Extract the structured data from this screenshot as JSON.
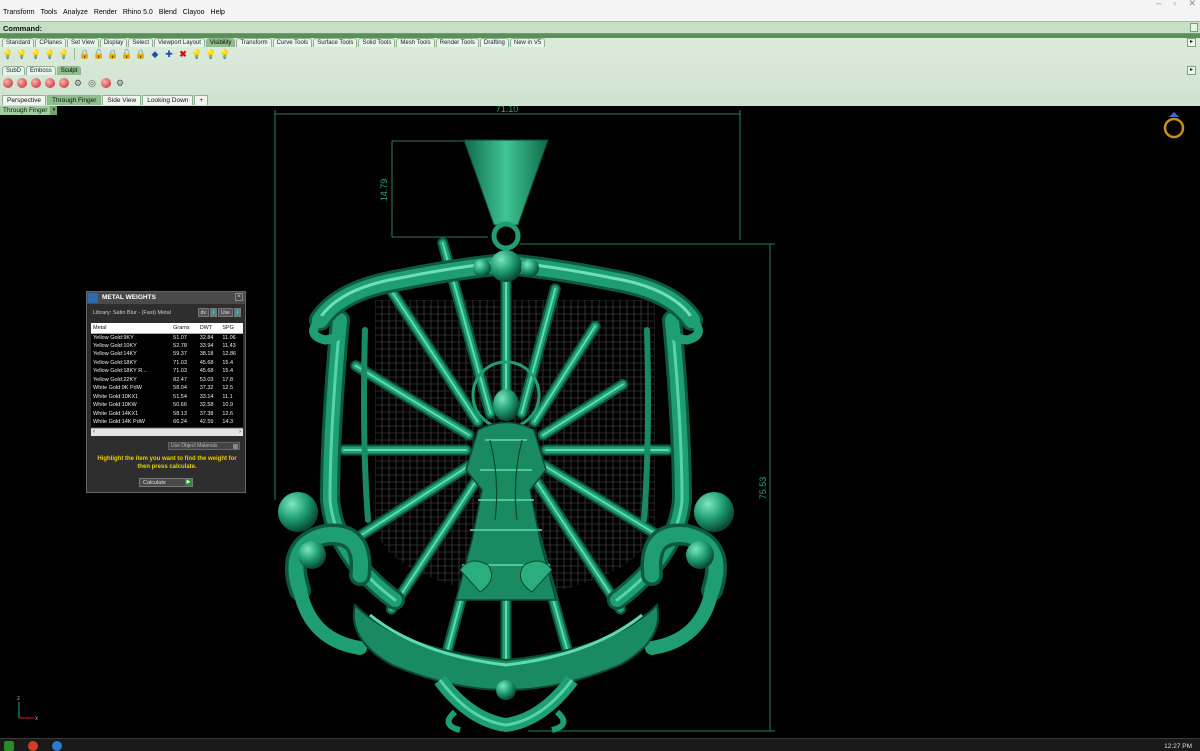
{
  "menu": [
    "Transform",
    "Tools",
    "Analyze",
    "Render",
    "Rhino 5.0",
    "Blend",
    "Clayoo",
    "Help"
  ],
  "command": {
    "label": "Command:"
  },
  "toolbar_tabs": [
    "Standard",
    "CPlanes",
    "Set View",
    "Display",
    "Select",
    "Viewport Layout",
    "Visibility",
    "Transform",
    "Curve Tools",
    "Surface Tools",
    "Solid Tools",
    "Mesh Tools",
    "Render Tools",
    "Drafting",
    "New in V5"
  ],
  "toolbar_tabs_active": 6,
  "sub_tabs": [
    "SubD",
    "Emboss",
    "Sculpt"
  ],
  "sub_tabs_active": 2,
  "viewport_tabs": [
    "Perspective",
    "Through Finger",
    "Side View",
    "Looking Down",
    "+"
  ],
  "viewport_tabs_active": 1,
  "viewport_label": "Through Finger",
  "dimensions": {
    "width": "71.10",
    "bail": "14.79",
    "height": "75.53"
  },
  "axis": {
    "z": "z",
    "x": "x"
  },
  "metal_weights": {
    "title": "METAL WEIGHTS",
    "library": "Library: Satin Blur - (Fast) Metal",
    "library_ctl": [
      "dv",
      "i",
      "Use",
      "i"
    ],
    "columns": [
      "Metal",
      "Grams",
      "DWT",
      "SPG"
    ],
    "rows": [
      [
        "Yellow Gold:9KY",
        "51.07",
        "32.84",
        "11.06"
      ],
      [
        "Yellow Gold:10KY",
        "52.78",
        "33.94",
        "11.43"
      ],
      [
        "Yellow Gold:14KY",
        "59.37",
        "38.18",
        "12.86"
      ],
      [
        "Yellow Gold:18KY",
        "71.03",
        "45.68",
        "15.4"
      ],
      [
        "Yellow Gold:18KY R...",
        "71.03",
        "45.68",
        "15.4"
      ],
      [
        "Yellow Gold:22KY",
        "82.47",
        "53.03",
        "17.8"
      ],
      [
        "White Gold:9K PdW",
        "58.04",
        "37.32",
        "12.5"
      ],
      [
        "White Gold:10KX1",
        "51.54",
        "33.14",
        "11.1"
      ],
      [
        "White Gold:10KW",
        "50.66",
        "32.58",
        "10.9"
      ],
      [
        "White Gold:14KX1",
        "58.13",
        "37.38",
        "12.6"
      ],
      [
        "White Gold:14K PdW",
        "66.24",
        "42.59",
        "14.3"
      ]
    ],
    "use_object_materials": "Use Object Materials",
    "hint": "Highlight the item you want to find the weight for then press calculate.",
    "calculate": "Calculate"
  },
  "clock": "12:27 PM",
  "colors": {
    "pendant": "#1f9e73",
    "pendant_light": "#46c99a",
    "pendant_dark": "#0c5b40",
    "dim_line": "#2fa57c",
    "grid": "#5a5a5a"
  }
}
